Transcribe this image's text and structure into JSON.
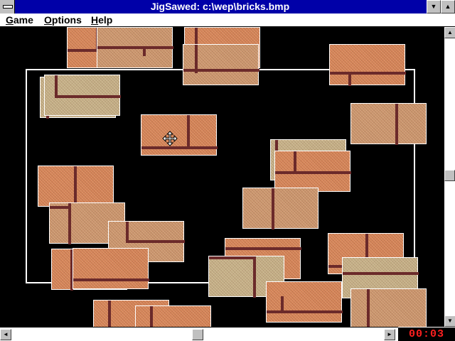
{
  "window": {
    "title": "JigSawed: c:\\wep\\bricks.bmp",
    "minimize_glyph": "▼",
    "maximize_glyph": "▲"
  },
  "menu": {
    "items": [
      {
        "label": "Game",
        "accel": "G",
        "rest": "ame"
      },
      {
        "label": "Options",
        "accel": "O",
        "rest": "ptions"
      },
      {
        "label": "Help",
        "accel": "H",
        "rest": "elp"
      }
    ]
  },
  "scrollbars": {
    "up_glyph": "▲",
    "down_glyph": "▼",
    "left_glyph": "◄",
    "right_glyph": "►"
  },
  "timer": {
    "value": "00:03",
    "color": "#ff2020"
  },
  "colors": {
    "titlebar": "#0000a8",
    "brick": "#d9885a",
    "mortar_light": "#c9b48a",
    "mortar_dark": "#6b2a2a"
  }
}
